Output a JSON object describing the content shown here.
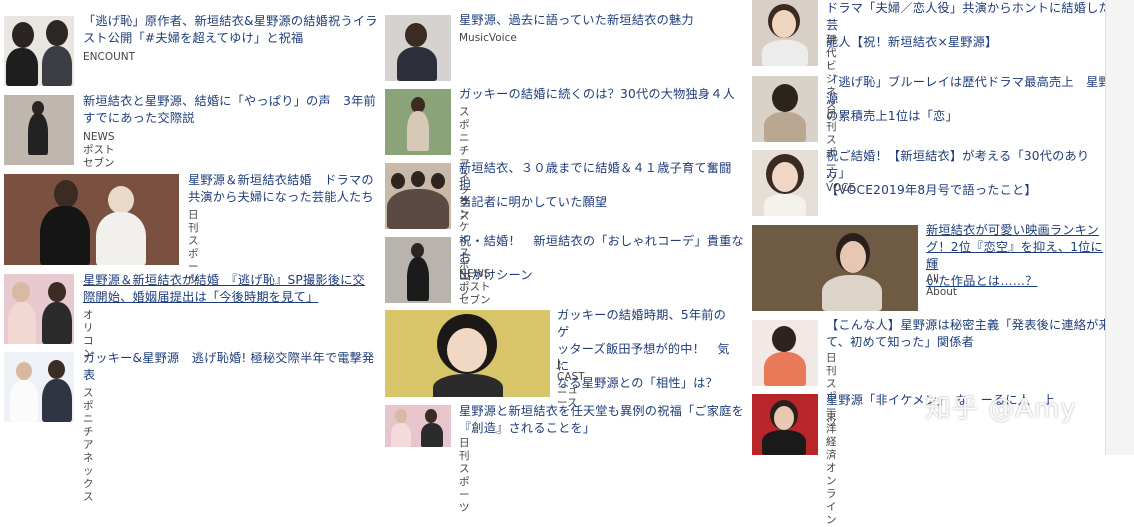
{
  "col1": [
    {
      "title": "「逃げ恥」原作者、新垣結衣&星野源の結婚祝うイラ\nスト公開「#夫婦を超えてゆけ」と祝福",
      "source": "ENCOUNT"
    },
    {
      "title": "新垣結衣と星野源、結婚に「やっぱり」の声　3年前\nすでにあった交際説",
      "source": "NEWSポストセブン"
    },
    {
      "title": "星野源＆新垣結衣結婚　ドラマの\n共演から夫婦になった芸能人たち",
      "source": "日刊スポーツ"
    },
    {
      "title": "星野源＆新垣結衣が結婚　『逃げ恥』SP撮影後に交\n際開始、婚姻届提出は「今後時期を見て」",
      "source": "オリコン"
    },
    {
      "title": "ガッキー&星野源　逃げ恥婚! 極秘交際半年で電撃発\n表",
      "source": "スポニチアネックス"
    }
  ],
  "col2": [
    {
      "title": "星野源、過去に語っていた新垣結衣の魅力",
      "source": "MusicVoice"
    },
    {
      "title": "ガッキーの結婚に続くのは？30代の大物独身４人",
      "source": "スポニチアネックス"
    },
    {
      "title": "新垣結衣、３０歳までに結婚＆４１歳子育て奮闘　担\n当記者に明かしていた願望",
      "source": "サンケイスポーツ"
    },
    {
      "title": "祝・結婚！　新垣結衣の「おしゃれコーデ」貴重なお\n出かけシーン",
      "source": "NEWSポストセブン"
    },
    {
      "title": "ガッキーの結婚時期、5年前のゲ\nッターズ飯田予想が的中！　気に\nなる星野源との「相性」は？",
      "source": "J-CASTニュース"
    },
    {
      "title": "星野源と新垣結衣を任天堂も異例の祝福「ご家庭を\n『創造』されることを」",
      "source": "日刊スポーツ"
    }
  ],
  "col3": [
    {
      "title": "ドラマ「夫婦／恋人役」共演からホントに結婚した芸\n能人【祝！新垣結衣×星野源】",
      "source": "現代ビジネス"
    },
    {
      "title": "「逃げ恥」ブルーレイは歴代ドラマ最高売上　星野源\nの累積売上1位は「恋」",
      "source": "日刊スポーツ"
    },
    {
      "title": "祝ご結婚！【新垣結衣】が考える「30代のあり方」\n【VOCE2019年8月号で語ったこと】",
      "source": "VOCE"
    },
    {
      "title": "新垣結衣が可愛い映画ランキン\nグ！2位『恋空』を抑え、1位に輝\nいた作品とは……？",
      "source": "All About"
    },
    {
      "title": "【こんな人】星野源は秘密主義「発表後に連絡が来\nて、初めて知った」関係者",
      "source": "日刊スポーツ"
    },
    {
      "title": "星野源「非イケメン」　な　ーるに人　上",
      "source": "東洋経済オンライン"
    }
  ],
  "watermark": "知乎 @Amy"
}
